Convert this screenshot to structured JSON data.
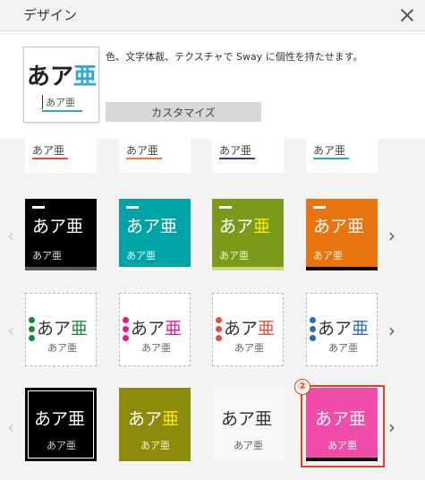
{
  "header": {
    "title": "デザイン"
  },
  "preview": {
    "kana": "あア",
    "kanji": "亜",
    "small": "あア亜",
    "accent": "#2ea8e0"
  },
  "description": "色、文字体裁、テクスチャで Sway に個性を持たせます。",
  "customize_button": "カスタマイズ",
  "tile_text": {
    "kana": "あア",
    "kanji": "亜",
    "small": "あア亜"
  },
  "callout": "②"
}
